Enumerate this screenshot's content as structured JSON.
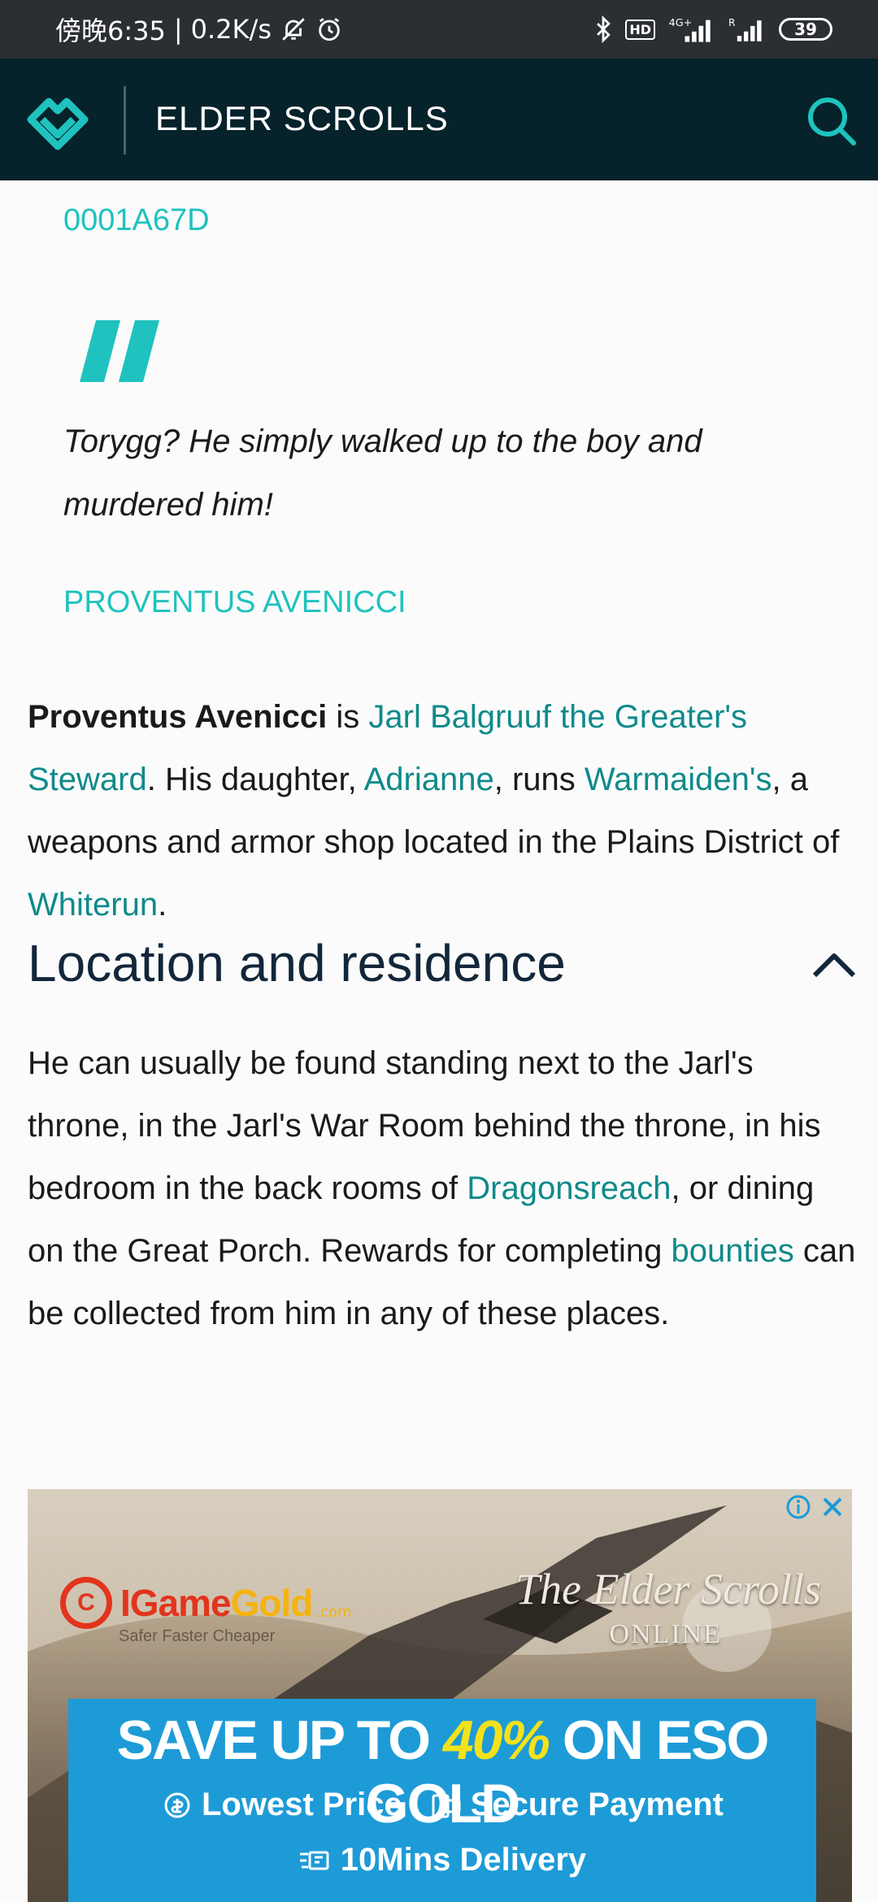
{
  "status_bar": {
    "time": "傍晚6:35",
    "separator": "|",
    "network_speed": "0.2K/s",
    "battery_level": "39",
    "hd_label": "HD",
    "icons": [
      "mute-bell-icon",
      "alarm-icon",
      "bluetooth-icon",
      "hd-icon",
      "signal-4g-icon",
      "signal-r-icon",
      "battery-icon"
    ]
  },
  "header": {
    "title": "ELDER SCROLLS",
    "logo_icon": "fandom-heart-logo",
    "search_icon": "search-icon",
    "colors": {
      "background": "#06222a",
      "accent": "#1fc2be"
    }
  },
  "infobox": {
    "form_id": "0001A67D"
  },
  "quote": {
    "text": "Torygg? He simply walked up to the boy and murdered him!",
    "author": "PROVENTUS AVENICCI"
  },
  "intro": {
    "subject": "Proventus Avenicci",
    "part1": " is ",
    "link_jarl": "Jarl Balgruuf the Greater's Steward",
    "part2": ". His daughter, ",
    "link_adrianne": "Adrianne",
    "part3": ", runs ",
    "link_warmaidens": "Warmaiden's",
    "part4": ", a weapons and armor shop located in the Plains District of ",
    "link_whiterun": "Whiterun",
    "part5": "."
  },
  "section": {
    "heading": "Location and residence",
    "toggle_icon": "chevron-up-icon",
    "part1": "He can usually be found standing next to the Jarl's throne, in the Jarl's War Room behind the throne, in his bedroom in the back rooms of ",
    "link_dragonsreach": "Dragonsreach",
    "part2": ", or dining on the Great Porch. Rewards for completing ",
    "link_bounties": "bounties",
    "part3": " can be collected from him in any of these places."
  },
  "ad": {
    "brand_letter": "C",
    "brand_name_1": "IGame",
    "brand_name_2": "Gold",
    "brand_tld": ".com",
    "brand_tagline": "Safer Faster Cheaper",
    "game_title": "The Elder Scrolls",
    "game_subtitle": "ONLINE",
    "headline_1": "SAVE UP TO ",
    "headline_highlight": "40%",
    "headline_2": " ON ESO GOLD",
    "feature_1": "Lowest Price",
    "feature_2": "Secure Payment",
    "feature_3": "10Mins Delivery",
    "info_icon": "ad-info-icon",
    "close_icon": "ad-close-icon"
  }
}
